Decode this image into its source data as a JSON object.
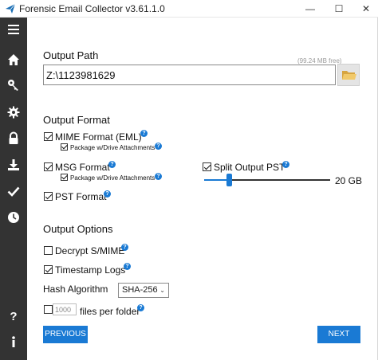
{
  "window": {
    "title": "Forensic Email Collector v3.61.1.0",
    "minimize": "—",
    "maximize": "☐",
    "close": "✕"
  },
  "sidebar": {
    "items": [
      {
        "icon": "menu-icon"
      },
      {
        "icon": "home-icon"
      },
      {
        "icon": "key-icon"
      },
      {
        "icon": "gear-icon"
      },
      {
        "icon": "lock-icon"
      },
      {
        "icon": "download-icon"
      },
      {
        "icon": "checkmark-icon"
      },
      {
        "icon": "clock-icon"
      },
      {
        "icon": "help-icon"
      },
      {
        "icon": "info-icon"
      }
    ]
  },
  "output_path": {
    "heading": "Output Path",
    "free_space": "(99.24 MB free)",
    "value": "Z:\\1123981629"
  },
  "output_format": {
    "heading": "Output Format",
    "mime_label": "MIME Format (EML)",
    "mime_checked": true,
    "mime_attach_label": "Package w/Drive Attachments",
    "mime_attach_checked": true,
    "msg_label": "MSG Format",
    "msg_checked": true,
    "msg_attach_label": "Package w/Drive Attachments",
    "msg_attach_checked": true,
    "pst_label": "PST Format",
    "pst_checked": true,
    "split_label": "Split Output PST",
    "split_checked": true,
    "split_value_label": "20 GB",
    "split_level": 0.2
  },
  "output_options": {
    "heading": "Output Options",
    "decrypt_label": "Decrypt S/MIME",
    "decrypt_checked": false,
    "timestamp_label": "Timestamp Logs",
    "timestamp_checked": true,
    "hash_label": "Hash Algorithm",
    "hash_value": "SHA-256",
    "files_checked": false,
    "files_value": "1000",
    "files_label": "files per folder"
  },
  "buttons": {
    "previous": "PREVIOUS",
    "next": "NEXT"
  },
  "colors": {
    "accent": "#1a7ad4",
    "sidebar": "#333333"
  }
}
